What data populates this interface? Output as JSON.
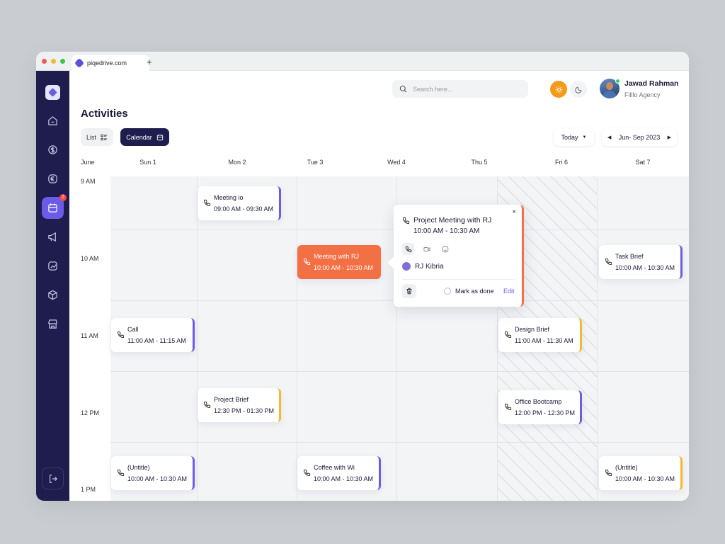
{
  "browser": {
    "tab_title": "piqedrive.com",
    "new_tab": "+"
  },
  "sidebar": {
    "items": [
      {
        "icon": "home-icon"
      },
      {
        "icon": "dollar-icon"
      },
      {
        "icon": "euro-icon"
      },
      {
        "icon": "calendar-icon",
        "active": true,
        "badge": "2"
      },
      {
        "icon": "megaphone-icon"
      },
      {
        "icon": "chart-icon"
      },
      {
        "icon": "box-icon"
      },
      {
        "icon": "store-icon"
      }
    ],
    "logout_icon": "logout-icon"
  },
  "header": {
    "search_placeholder": "Search here...",
    "user_name": "Jawad Rahman",
    "user_org": "Filllo Agency"
  },
  "page": {
    "title": "Activities",
    "view_list": "List",
    "view_calendar": "Calendar",
    "today": "Today",
    "range": "Jun- Sep 2023"
  },
  "calendar": {
    "month": "June",
    "days": [
      "Sun 1",
      "Mon 2",
      "Tue 3",
      "Wed 4",
      "Thu 5",
      "Fri 6",
      "Sat 7"
    ],
    "times": [
      "9 AM",
      "10 AM",
      "11 AM",
      "12 PM",
      "1 PM"
    ],
    "events": [
      {
        "day": "Mon 2",
        "title": "Meeting io",
        "time": "09:00 AM - 09:30 AM",
        "accent": "#6b5ce7"
      },
      {
        "day": "Tue 3",
        "title": "Meeting with RJ",
        "time": "10:00 AM - 10:30 AM",
        "accent": "#f36f44"
      },
      {
        "day": "Sat 7",
        "title": "Task Brief",
        "time": "10:00 AM - 10:30 AM",
        "accent": "#6b5ce7"
      },
      {
        "day": "Sun 1",
        "title": "Call",
        "time": "11:00 AM - 11:15 AM",
        "accent": "#6b5ce7"
      },
      {
        "day": "Fri 6",
        "title": "Design Brief",
        "time": "11:00 AM - 11:30 AM",
        "accent": "#f5b82e"
      },
      {
        "day": "Mon 2",
        "title": "Project Brief",
        "time": "12:30 PM - 01:30 PM",
        "accent": "#f5b82e"
      },
      {
        "day": "Fri 6",
        "title": "Office Bootcamp",
        "time": "12:00 PM - 12:30 PM",
        "accent": "#6b5ce7"
      },
      {
        "day": "Sun 1",
        "title": "(Untitle)",
        "time": "10:00 AM - 10:30 AM",
        "accent": "#6b5ce7"
      },
      {
        "day": "Tue 3",
        "title": "Coffee with Wi",
        "time": "10:00 AM - 10:30 AM",
        "accent": "#6b5ce7"
      },
      {
        "day": "Sat 7",
        "title": "(Untitle)",
        "time": "10:00 AM - 10:30 AM",
        "accent": "#f5b82e"
      }
    ]
  },
  "popup": {
    "title": "Project Meeting with RJ",
    "time": "10:00 AM - 10:30 AM",
    "close": "×",
    "person": "RJ Kibria",
    "mark_done": "Mark as done",
    "edit": "Edit"
  }
}
